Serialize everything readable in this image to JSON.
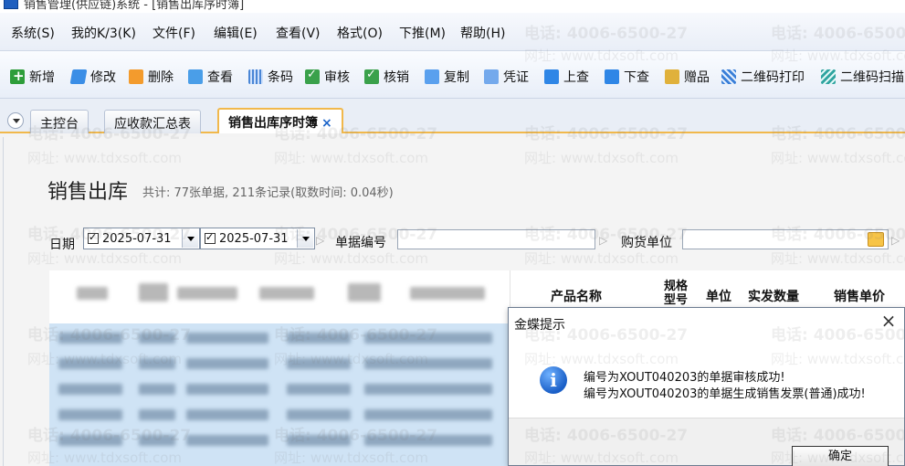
{
  "window": {
    "title": "销售管理(供应链)系统 - [销售出库序时簿]"
  },
  "menu": [
    "系统(S)",
    "我的K/3(K)",
    "文件(F)",
    "编辑(E)",
    "查看(V)",
    "格式(O)",
    "下推(M)",
    "帮助(H)"
  ],
  "toolbar": [
    {
      "label": "新增",
      "icon": "add-icon"
    },
    {
      "label": "修改",
      "icon": "edit-icon"
    },
    {
      "label": "删除",
      "icon": "delete-icon"
    },
    {
      "label": "查看",
      "icon": "view-icon"
    },
    {
      "label": "条码",
      "icon": "barcode-icon"
    },
    {
      "label": "审核",
      "icon": "audit-icon"
    },
    {
      "label": "核销",
      "icon": "verify-icon"
    },
    {
      "label": "复制",
      "icon": "copy-icon"
    },
    {
      "label": "凭证",
      "icon": "voucher-icon"
    },
    {
      "label": "上查",
      "icon": "trace-up-icon"
    },
    {
      "label": "下查",
      "icon": "trace-down-icon"
    },
    {
      "label": "赠品",
      "icon": "gift-icon"
    },
    {
      "label": "二维码打印",
      "icon": "qrcode-print-icon"
    },
    {
      "label": "二维码扫描",
      "icon": "qrcode-scan-icon"
    }
  ],
  "tabs": [
    {
      "label": "主控台"
    },
    {
      "label": "应收款汇总表"
    },
    {
      "label": "销售出库序时簿",
      "active": true,
      "close": "×"
    }
  ],
  "page": {
    "title": "销售出库",
    "stats": "共计: 77张单据, 211条记录(取数时间: 0.04秒)"
  },
  "filters": {
    "date_label": "日期",
    "date_from": "2025-07-31",
    "date_to": "2025-07-31",
    "billno_label": "单据编号",
    "billno_value": "",
    "customer_label": "购货单位",
    "customer_value": ""
  },
  "table": {
    "columns": [
      "产品名称",
      "规格型号",
      "单位",
      "实发数量",
      "销售单价"
    ]
  },
  "watermark": {
    "phone": "电话: 4006-6500-27",
    "site": "网址: www.tdxsoft.com"
  },
  "dialog": {
    "title": "金蝶提示",
    "close": "×",
    "messages": [
      "编号为XOUT040203的单据审核成功!",
      "编号为XOUT040203的单据生成销售发票(普通)成功!"
    ],
    "ok": "确定"
  },
  "colors": {
    "tab_accent": "#f1b84b",
    "selection": "#cfe3f5",
    "info_blue": "#1a5fc7"
  }
}
